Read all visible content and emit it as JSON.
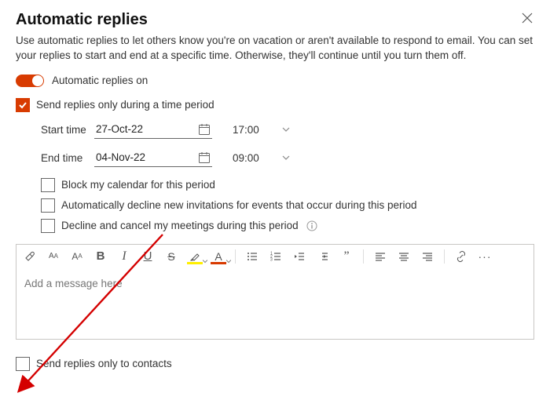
{
  "header": {
    "title": "Automatic replies",
    "description": "Use automatic replies to let others know you're on vacation or aren't available to respond to email. You can set your replies to start and end at a specific time. Otherwise, they'll continue until you turn them off."
  },
  "toggle": {
    "label": "Automatic replies on",
    "state": true
  },
  "time_period": {
    "checkbox_label": "Send replies only during a time period",
    "checked": true,
    "start_label": "Start time",
    "start_date": "27-Oct-22",
    "start_time": "17:00",
    "end_label": "End time",
    "end_date": "04-Nov-22",
    "end_time": "09:00"
  },
  "sub_options": {
    "block_calendar": "Block my calendar for this period",
    "decline_new": "Automatically decline new invitations for events that occur during this period",
    "decline_cancel": "Decline and cancel my meetings during this period"
  },
  "editor": {
    "placeholder": "Add a message here",
    "tools": {
      "brush": "format-painter",
      "font_minus": "decrease-font",
      "font_plus": "increase-font",
      "bold": "B",
      "italic": "I",
      "underline": "U",
      "strike": "S",
      "highlight": "highlight",
      "font_color": "A",
      "bullets": "bulleted-list",
      "numbers": "numbered-list",
      "outdent": "outdent",
      "indent": "indent",
      "quote": "quote",
      "align_left": "align-left",
      "align_center": "align-center",
      "align_right": "align-right",
      "link": "link",
      "more": "more"
    }
  },
  "contacts_only": {
    "label": "Send replies only to contacts",
    "checked": false
  }
}
